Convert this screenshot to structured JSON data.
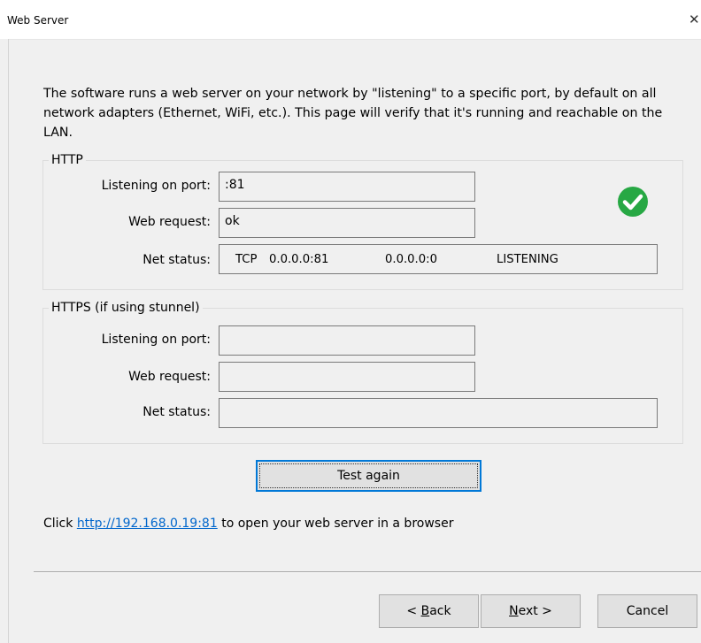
{
  "window": {
    "title": "Web Server",
    "close_glyph": "✕"
  },
  "description": "The software runs a web server on your network by \"listening\" to a specific port, by default on all network adapters (Ethernet, WiFi, etc.).  This page will verify that it's running and reachable on the LAN.",
  "http": {
    "legend": "HTTP",
    "port_label": "Listening on port:",
    "port_value": ":81",
    "request_label": "Web request:",
    "request_value": "ok",
    "netstatus_label": "Net status:",
    "netstatus": {
      "proto": "TCP",
      "local": "0.0.0.0:81",
      "foreign": "0.0.0.0:0",
      "state": "LISTENING"
    },
    "status_icon": "check-circle-icon",
    "status_color": "#27a844"
  },
  "https": {
    "legend": "HTTPS (if using stunnel)",
    "port_label": "Listening on port:",
    "port_value": "",
    "request_label": "Web request:",
    "request_value": "",
    "netstatus_label": "Net status:",
    "netstatus_value": ""
  },
  "test_button": "Test again",
  "link_line": {
    "prefix": "Click ",
    "url": "http://192.168.0.19:81",
    "suffix": " to open your web server in a browser"
  },
  "footer": {
    "back_mnemonic": "B",
    "back_rest": "ack",
    "back_prefix": "< ",
    "next_mnemonic": "N",
    "next_rest": "ext >",
    "cancel": "Cancel"
  }
}
